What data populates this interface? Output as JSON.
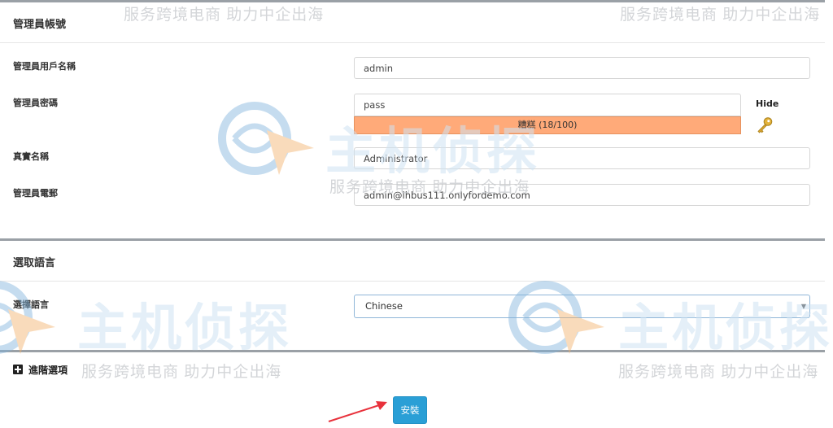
{
  "account_section": {
    "title": "管理員帳號",
    "fields": {
      "username": {
        "label": "管理員用戶名稱",
        "value": "admin"
      },
      "password": {
        "label": "管理員密碼",
        "value": "pass",
        "strength_text": "糟糕 (18/100)",
        "hide_label": "Hide"
      },
      "realname": {
        "label": "真實名稱",
        "value": "Administrator"
      },
      "email": {
        "label": "管理員電郵",
        "value": "admin@lhbus111.onlyfordemo.com"
      }
    }
  },
  "language_section": {
    "title": "選取語言",
    "label": "選擇語言",
    "selected": "Chinese"
  },
  "advanced": {
    "label": "進階選項"
  },
  "install_button": {
    "label": "安裝"
  },
  "watermark": {
    "slogan": "服务跨境电商 助力中企出海",
    "brand": "主机侦探"
  },
  "colors": {
    "strength_bar": "#ffaa79",
    "button": "#2a9fd6",
    "select_border": "#8fb6d8",
    "arrow": "#e8323c"
  }
}
